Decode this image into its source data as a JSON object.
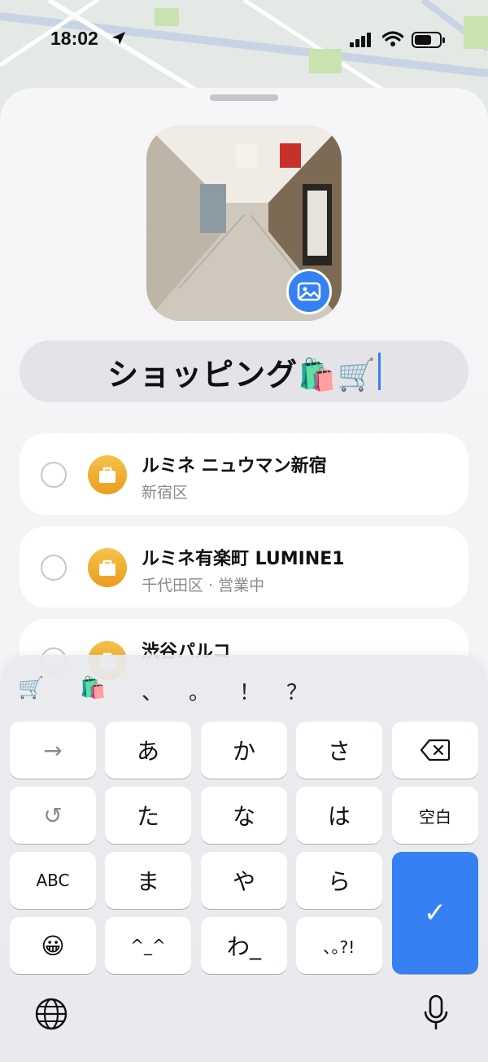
{
  "status": {
    "time": "18:02"
  },
  "list_name": "ショッピング🛍️🛒",
  "places": [
    {
      "title": "ルミネ ニュウマン新宿",
      "subtitle": "新宿区"
    },
    {
      "title": "ルミネ有楽町 LUMINE1",
      "subtitle": "千代田区 · 営業中"
    },
    {
      "title": "渋谷パルコ",
      "subtitle": ""
    }
  ],
  "keyboard": {
    "candidates": [
      "🛒",
      "🛍️",
      "、",
      "。",
      "！",
      "？"
    ],
    "keys": {
      "next": "→",
      "a": "あ",
      "ka": "か",
      "sa": "さ",
      "undo": "↺",
      "ta": "た",
      "na": "な",
      "ha": "は",
      "space": "空白",
      "abc": "ABC",
      "ma": "ま",
      "ya": "や",
      "ra": "ら",
      "emoji": "😀",
      "kaomoji": "^_^",
      "wa": "わ_",
      "punct": "､｡?!",
      "confirm": "✓"
    }
  },
  "colors": {
    "accent": "#3580f2",
    "place_icon": "#f0a52a"
  }
}
